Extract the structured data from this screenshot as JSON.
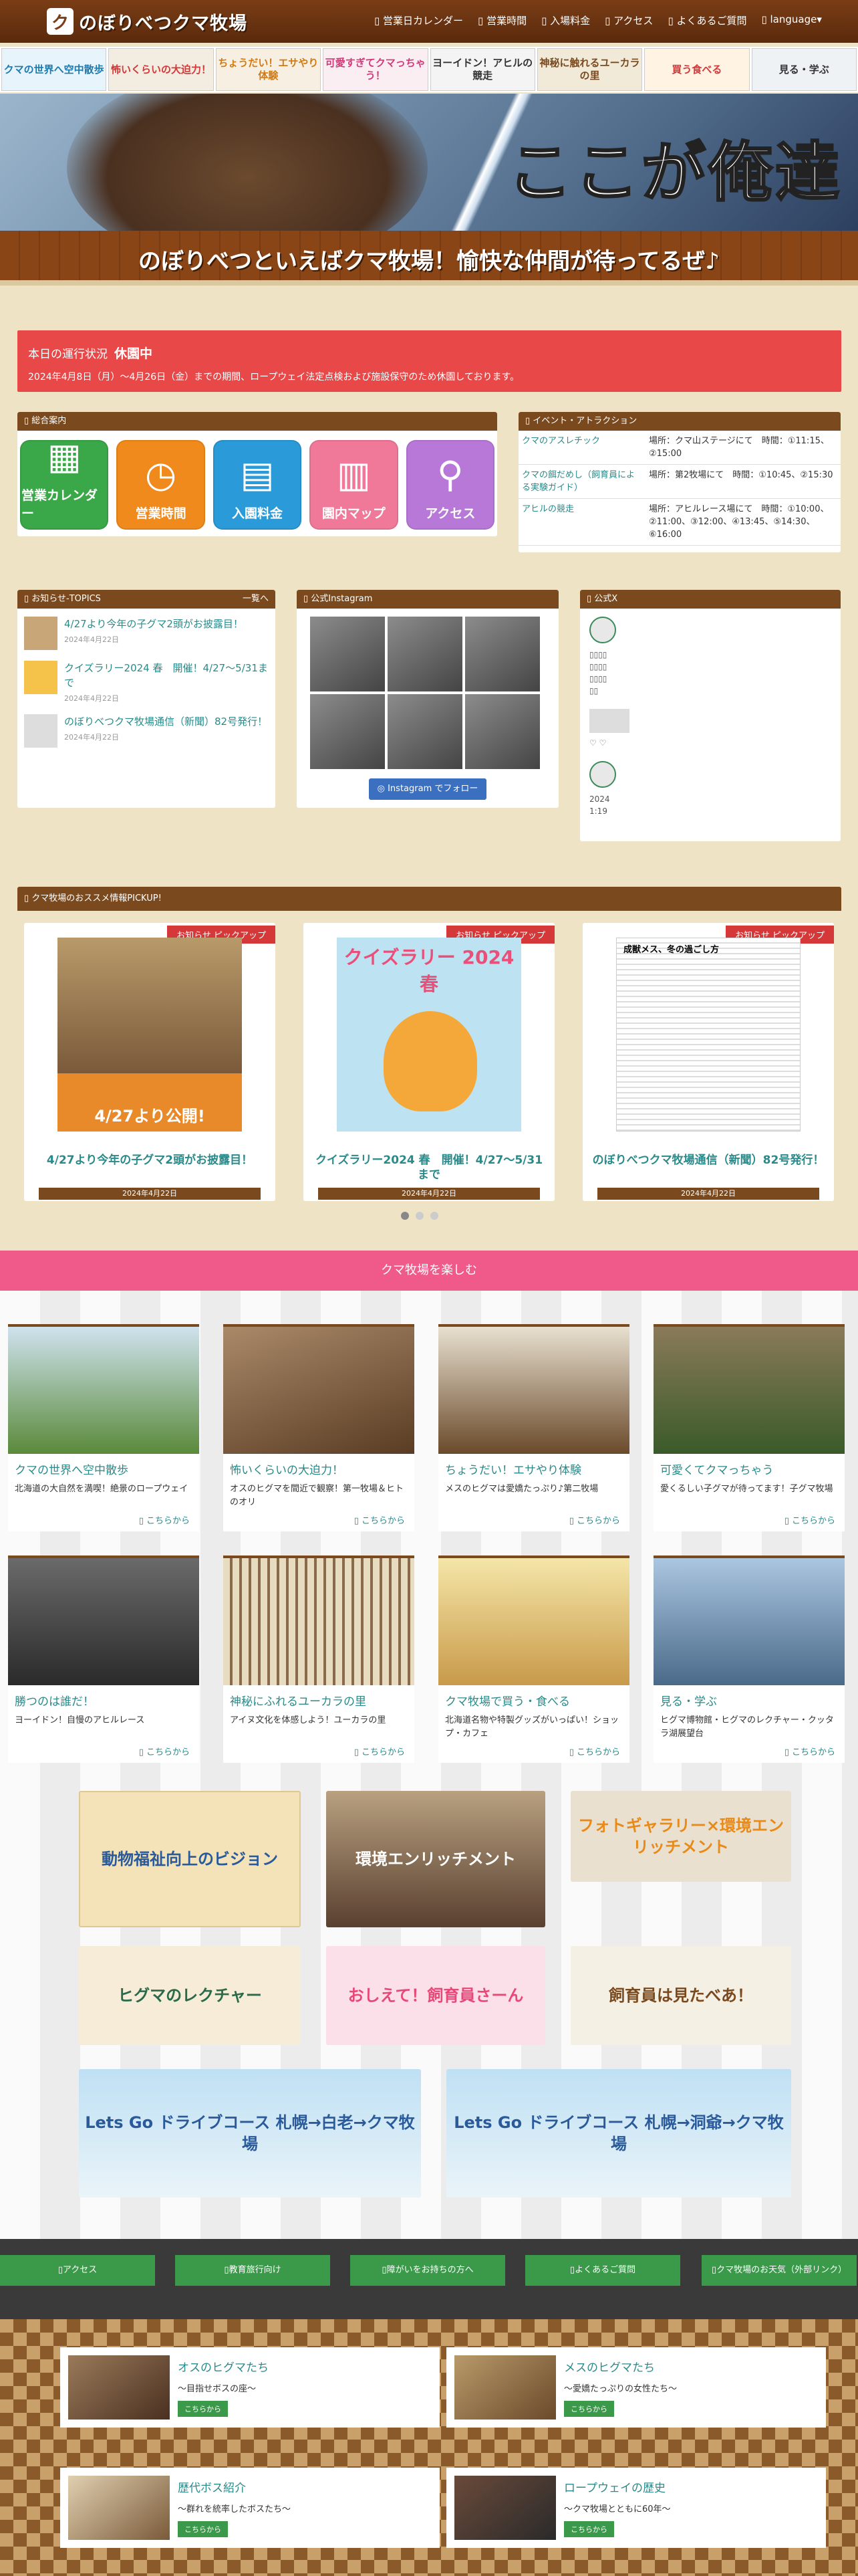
{
  "header": {
    "logo_text": "のぼりべつクマ牧場",
    "nav": [
      "営業日カレンダー",
      "営業時間",
      "入場料金",
      "アクセス",
      "よくあるご質問",
      "language"
    ]
  },
  "strip": [
    "クマの世界へ空中散歩",
    "怖いくらいの大迫力！",
    "ちょうだい！エサやり体験",
    "可愛すぎてクマっちゃう！",
    "ヨーイドン！アヒルの競走",
    "神秘に触れるユーカラの里",
    "買う食べる",
    "見る・学ぶ"
  ],
  "hero": {
    "catch": "ここが俺達の山",
    "band": "のぼりべつといえばクマ牧場！愉快な仲間が待ってるぜ♪"
  },
  "notice": {
    "label": "本日の運行状況",
    "status": "休園中",
    "text": "2024年4月8日（月）～4月26日（金）までの期間、ロープウェイ法定点検および施設保守のため休園しております。"
  },
  "guide": {
    "title": "総合案内",
    "items": [
      "営業カレンダー",
      "営業時間",
      "入園料金",
      "園内マップ",
      "アクセス"
    ]
  },
  "events": {
    "title": "イベント・アトラクション",
    "rows": [
      {
        "name": "クマのアスレチック",
        "info": "場所：クマ山ステージにて　時間：①11:15、②15:00"
      },
      {
        "name": "クマの餌だめし（飼育員による実験ガイド）",
        "info": "場所：第2牧場にて　時間：①10:45、②15:30"
      },
      {
        "name": "アヒルの競走",
        "info": "場所：アヒルレース場にて　時間：①10:00、②11:00、③12:00、④13:45、⑤14:30、⑥16:00"
      }
    ]
  },
  "topics": {
    "title": "お知らせ-TOPICS",
    "more": "一覧へ",
    "items": [
      {
        "title": "4/27より今年の子グマ2頭がお披露目！",
        "date": "2024年4月22日"
      },
      {
        "title": "クイズラリー2024 春　開催！4/27～5/31まで",
        "date": "2024年4月22日"
      },
      {
        "title": "のぼりべつクマ牧場通信（新聞）82号発行！",
        "date": "2024年4月22日"
      }
    ]
  },
  "insta": {
    "title": "公式Instagram",
    "button": "Instagram でフォロー"
  },
  "xpost": {
    "title": "公式X",
    "date": "2024",
    "time": "1:19"
  },
  "pickup": {
    "title": "クマ牧場のおススメ情報PICKUP!",
    "ribbon": "お知らせ ピックアップ",
    "cards": [
      {
        "img": "4/27より公開!",
        "title": "4/27より今年の子グマ2頭がお披露目！",
        "date": "2024年4月22日"
      },
      {
        "img": "クイズラリー 2024春",
        "title": "クイズラリー2024 春　開催！4/27～5/31まで",
        "date": "2024年4月22日"
      },
      {
        "img": "成獣メス、冬の過ごし方",
        "title": "のぼりべつクマ牧場通信（新聞）82号発行！",
        "date": "2024年4月22日"
      }
    ]
  },
  "enjoy": {
    "title": "クマ牧場を楽しむ",
    "link": "こちらから",
    "cards": [
      {
        "title": "クマの世界へ空中散歩",
        "desc": "北海道の大自然を満喫！絶景のロープウェイ"
      },
      {
        "title": "怖いくらいの大迫力！",
        "desc": "オスのヒグマを間近で観察！第一牧場＆ヒトのオリ"
      },
      {
        "title": "ちょうだい！エサやり体験",
        "desc": "メスのヒグマは愛嬌たっぷり♪第二牧場"
      },
      {
        "title": "可愛くてクマっちゃう",
        "desc": "愛くるしい子グマが待ってます！子グマ牧場"
      },
      {
        "title": "勝つのは誰だ！",
        "desc": "ヨーイドン！自慢のアヒルレース"
      },
      {
        "title": "神秘にふれるユーカラの里",
        "desc": "アイヌ文化を体感しよう！ユーカラの里"
      },
      {
        "title": "クマ牧場で買う・食べる",
        "desc": "北海道名物や特製グッズがいっぱい！ショップ・カフェ"
      },
      {
        "title": "見る・学ぶ",
        "desc": "ヒグマ博物館・ヒグマのレクチャー・クッタラ湖展望台"
      }
    ]
  },
  "banners": [
    {
      "text": "動物福祉向上のビジョン"
    },
    {
      "text": "環境エンリッチメント"
    },
    {
      "text": "フォトギャラリー×環境エンリッチメント"
    },
    {
      "text": "ヒグマのレクチャー"
    },
    {
      "text": "おしえて！飼育員さーん"
    },
    {
      "text": "飼育員は見たべあ！"
    },
    {
      "text": "Lets Go ドライブコース 札幌→白老→クマ牧場"
    },
    {
      "text": "Lets Go ドライブコース 札幌→洞爺→クマ牧場"
    }
  ],
  "footer_nav": [
    "アクセス",
    "教育旅行向け",
    "障がいをお持ちの方へ",
    "よくあるご質問",
    "クマ牧場のお天気（外部リンク）"
  ],
  "footer_cards": [
    {
      "title": "オスのヒグマたち",
      "sub": "～目指せボスの座～",
      "btn": "こちらから"
    },
    {
      "title": "メスのヒグマたち",
      "sub": "～愛嬌たっぷりの女性たち～",
      "btn": "こちらから"
    },
    {
      "title": "歴代ボス紹介",
      "sub": "～群れを統率したボスたち～",
      "btn": "こちらから"
    },
    {
      "title": "ロープウェイの歴史",
      "sub": "～クマ牧場とともに60年～",
      "btn": "こちらから"
    }
  ],
  "colors": {
    "brown": "#7a4a1e",
    "green": "#3a9a4a",
    "teal": "#2a8a8a",
    "red": "#e84848",
    "pink": "#ef5a8a"
  }
}
